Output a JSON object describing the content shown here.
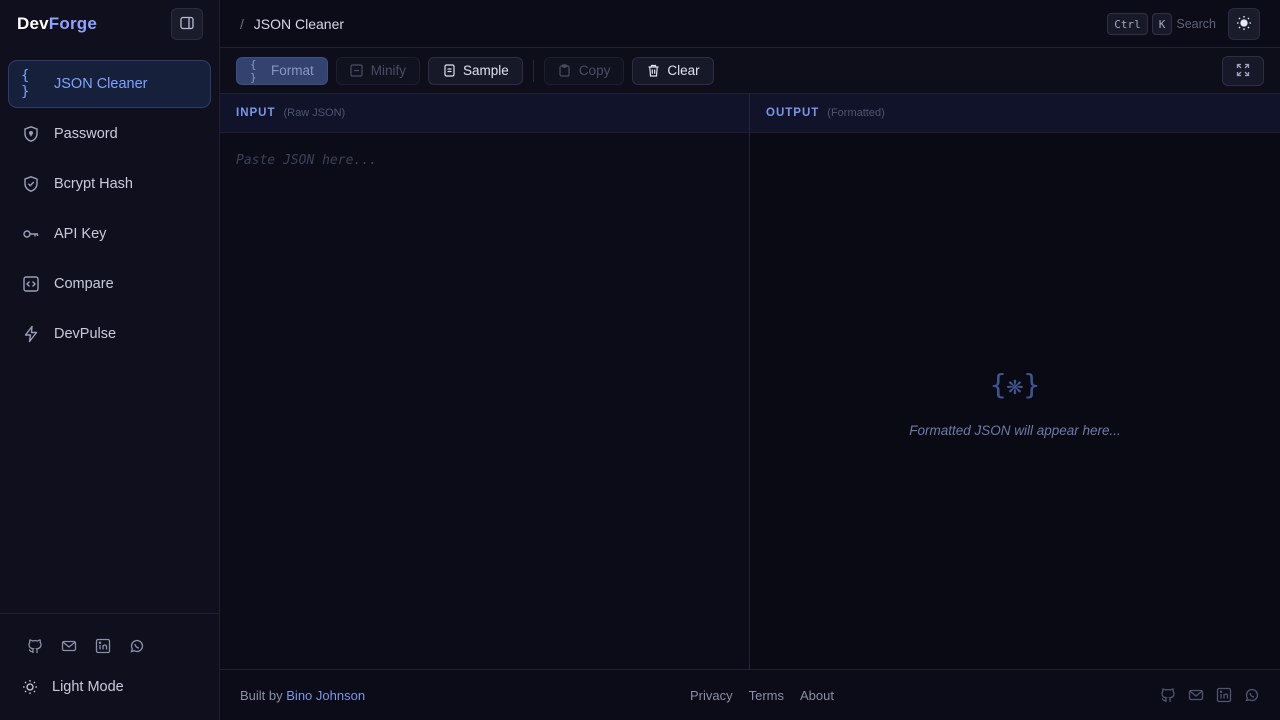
{
  "app": {
    "logo_part1": "Dev",
    "logo_part2": "Forge"
  },
  "sidebar": {
    "items": [
      {
        "label": "JSON Cleaner",
        "icon": "braces-icon",
        "active": true
      },
      {
        "label": "Password",
        "icon": "shield-icon"
      },
      {
        "label": "Bcrypt Hash",
        "icon": "shield-check-icon"
      },
      {
        "label": "API Key",
        "icon": "key-icon"
      },
      {
        "label": "Compare",
        "icon": "code-compare-icon"
      },
      {
        "label": "DevPulse",
        "icon": "lightning-icon"
      }
    ],
    "socials": [
      "github-icon",
      "mail-icon",
      "linkedin-icon",
      "whatsapp-icon"
    ],
    "theme_toggle_label": "Light Mode"
  },
  "topbar": {
    "breadcrumb_sep": "/",
    "breadcrumb_current": "JSON Cleaner",
    "shortcut_key1": "Ctrl",
    "shortcut_key2": "K",
    "search_label": "Search"
  },
  "toolbar": {
    "format_label": "Format",
    "minify_label": "Minify",
    "sample_label": "Sample",
    "copy_label": "Copy",
    "clear_label": "Clear"
  },
  "input_pane": {
    "title": "INPUT",
    "subtitle": "(Raw JSON)",
    "placeholder": "Paste JSON here..."
  },
  "output_pane": {
    "title": "OUTPUT",
    "subtitle": "(Formatted)",
    "empty_icon": "{❋}",
    "empty_text": "Formatted JSON will appear here..."
  },
  "footer": {
    "built_prefix": "Built by",
    "author": "Bino Johnson",
    "links": [
      "Privacy",
      "Terms",
      "About"
    ]
  },
  "colors": {
    "accent": "#7c96e8",
    "background": "#0c0c18",
    "active_nav_bg": "#17203a"
  }
}
